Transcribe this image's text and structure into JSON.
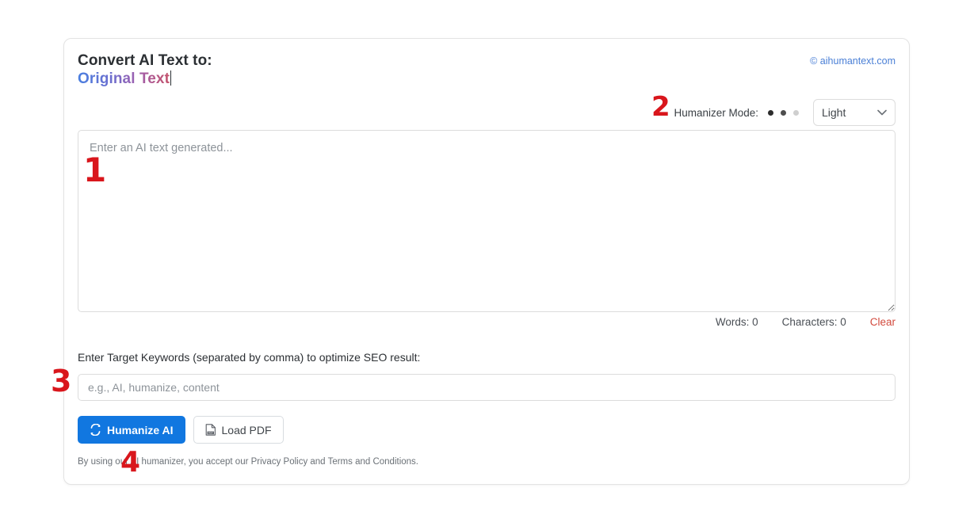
{
  "brand": {
    "credit": "© aihumantext.com",
    "credit_icon": "copyright-icon",
    "accent_blue": "#1177e0",
    "link_blue": "#4a7fd6",
    "clear_red": "#d24a3d",
    "annotation_red": "#d9161c"
  },
  "header": {
    "title_line1": "Convert AI Text to:",
    "title_line2": "Original Text"
  },
  "mode": {
    "label": "Humanizer Mode:",
    "dots": [
      "filled",
      "filled",
      "empty"
    ],
    "selected": "Light",
    "options": [
      "Light"
    ],
    "chevron_icon": "chevron-down-icon"
  },
  "input": {
    "placeholder": "Enter an AI text generated...",
    "value": "",
    "resize_handle_icon": "resize-handle-icon"
  },
  "counters": {
    "words_label": "Words:",
    "words_value": "0",
    "characters_label": "Characters:",
    "characters_value": "0",
    "clear_label": "Clear"
  },
  "keywords": {
    "label": "Enter Target Keywords (separated by comma) to optimize SEO result:",
    "placeholder": "e.g., AI, humanize, content",
    "value": ""
  },
  "actions": {
    "humanize_label": "Humanize AI",
    "humanize_icon": "sync-refresh-icon",
    "load_pdf_label": "Load PDF",
    "load_pdf_icon": "pdf-file-icon"
  },
  "footer": {
    "note": "By using our AI humanizer, you accept our Privacy Policy and Terms and Conditions."
  },
  "annotations": {
    "one": "1",
    "two": "2",
    "three": "3",
    "four": "4"
  }
}
